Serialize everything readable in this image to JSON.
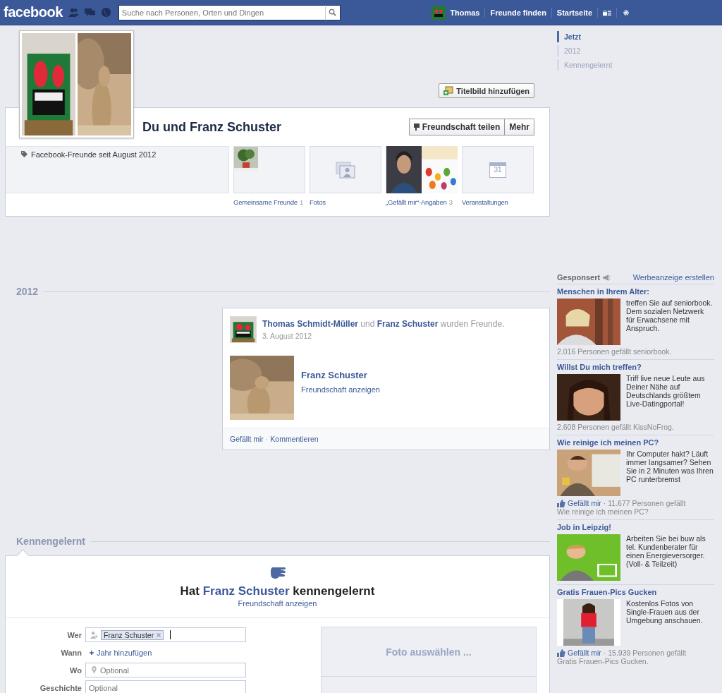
{
  "topbar": {
    "logo": "facebook",
    "search": {
      "placeholder": "Suche nach Personen, Orten und Dingen"
    },
    "user": "Thomas",
    "links": [
      "Freunde finden",
      "Startseite"
    ]
  },
  "cover": {
    "button": "Titelbild hinzufügen"
  },
  "header": {
    "title": "Du und Franz Schuster",
    "buttons": [
      "Freundschaft teilen",
      "Mehr"
    ],
    "info": "Facebook-Freunde seit August 2012",
    "tiles": [
      {
        "kind": "friends",
        "label": "Gemeinsame Freunde",
        "count": "1"
      },
      {
        "kind": "photos",
        "label": "Fotos"
      },
      {
        "kind": "likes",
        "label": "„Gefällt mir“-Angaben",
        "count": "3"
      },
      {
        "kind": "calendar",
        "label": "Veranstaltungen",
        "day": "31"
      }
    ]
  },
  "year_section": {
    "heading": "2012",
    "story": {
      "actor": "Thomas Schmidt-Müller",
      "connector": "und",
      "friend": "Franz Schuster",
      "tail": "wurden Freunde.",
      "date": "3. August 2012",
      "attachment_title": "Franz Schuster",
      "attachment_link": "Freundschaft anzeigen",
      "actions": [
        "Gefällt mir",
        "Kommentieren"
      ],
      "separator": "·"
    }
  },
  "met_section": {
    "heading": "Kennengelernt",
    "title_before": "Hat",
    "title_name": "Franz Schuster",
    "title_after": "kennengelernt",
    "link": "Freundschaft anzeigen",
    "fields": [
      {
        "kind": "tokens",
        "label": "Wer",
        "token": "Franz Schuster"
      },
      {
        "kind": "link",
        "label": "Wann",
        "value": "Jahr hinzufügen"
      },
      {
        "kind": "place",
        "label": "Wo",
        "placeholder": "Optional"
      },
      {
        "kind": "text",
        "label": "Geschichte",
        "placeholder": "Optional"
      }
    ],
    "photo_button": "Foto auswählen ..."
  },
  "timeline_nav": [
    {
      "label": "Jetzt",
      "selected": true
    },
    {
      "label": "2012",
      "selected": false
    },
    {
      "label": "Kennengelernt",
      "selected": false
    }
  ],
  "ads": {
    "heading": "Gesponsert",
    "create_link": "Werbeanzeige erstellen",
    "items": [
      {
        "kind": "count",
        "title": "Menschen in Ihrem Alter:",
        "text": "treffen Sie auf seniorbook. Dem sozialen Netzwerk für Erwachsene mit Anspruch.",
        "social": "2.016 Personen gefällt seniorbook."
      },
      {
        "kind": "count",
        "title": "Willst Du mich treffen?",
        "text": "Triff live neue Leute aus Deiner Nähe auf Deutschlands größtem Live-Datingportal!",
        "social": "2.608 Personen gefällt KissNoFrog."
      },
      {
        "kind": "like",
        "title": "Wie reinige ich meinen PC?",
        "text": "Ihr Computer hakt? Läuft immer langsamer? Sehen Sie in 2 Minuten was Ihren PC runterbremst",
        "like": "Gefällt mir",
        "social": "· 11.677 Personen gefällt",
        "sub": "Wie reinige ich meinen PC?"
      },
      {
        "kind": "none",
        "title": "Job in Leipzig!",
        "text": "Arbeiten Sie bei buw als tel. Kundenberater für einen Energieversorger. (Voll- & Teilzeit)"
      },
      {
        "kind": "like",
        "title": "Gratis Frauen-Pics Gucken",
        "text": "Kostenlos Fotos von Single-Frauen aus der Umgebung anschauen.",
        "like": "Gefällt mir",
        "social": "· 15.939 Personen gefällt",
        "sub": "Gratis Frauen-Pics Gucken."
      }
    ]
  }
}
